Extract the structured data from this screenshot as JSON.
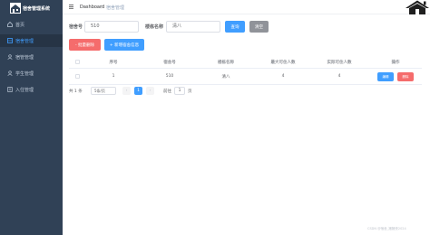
{
  "brand": {
    "name": "宿舍管理系统"
  },
  "sidebar": {
    "items": [
      {
        "label": "首页",
        "icon": "home-icon"
      },
      {
        "label": "宿舍管理",
        "icon": "dorm-icon"
      },
      {
        "label": "宿管管理",
        "icon": "manager-icon"
      },
      {
        "label": "学生管理",
        "icon": "student-icon"
      },
      {
        "label": "入住管理",
        "icon": "checkin-icon"
      }
    ]
  },
  "header": {
    "breadcrumb_home": "Dashboard",
    "breadcrumb_sep": "/",
    "breadcrumb_current": "宿舍管理"
  },
  "search": {
    "dorm_no_label": "宿舍号",
    "dorm_no_value": "510",
    "building_label": "楼栋名称",
    "building_value": "清八",
    "query_button": "查询",
    "reset_button": "清空"
  },
  "toolbar": {
    "batch_delete": "- 批量删除",
    "add": "+ 新增宿舍信息"
  },
  "table": {
    "headers": [
      "序号",
      "宿舍号",
      "楼栋名称",
      "最大可住人数",
      "实际可住人数",
      "操作"
    ],
    "rows": [
      {
        "index": "1",
        "dorm_no": "510",
        "building": "清八",
        "max": "4",
        "actual": "4",
        "edit": "编辑",
        "delete": "删除"
      }
    ]
  },
  "pagination": {
    "total": "共 1 条",
    "page_size": "5条/页",
    "prev": "‹",
    "current_page": "1",
    "next": "›",
    "goto_label": "前往",
    "goto_value": "1",
    "page_unit": "页"
  },
  "watermark": "CSDN @宿舍_猪猪侠2024",
  "colors": {
    "sidebar_bg": "#304156",
    "sidebar_active_text": "#409eff",
    "primary": "#409eff",
    "danger": "#f56c6c",
    "gray": "#909399"
  }
}
